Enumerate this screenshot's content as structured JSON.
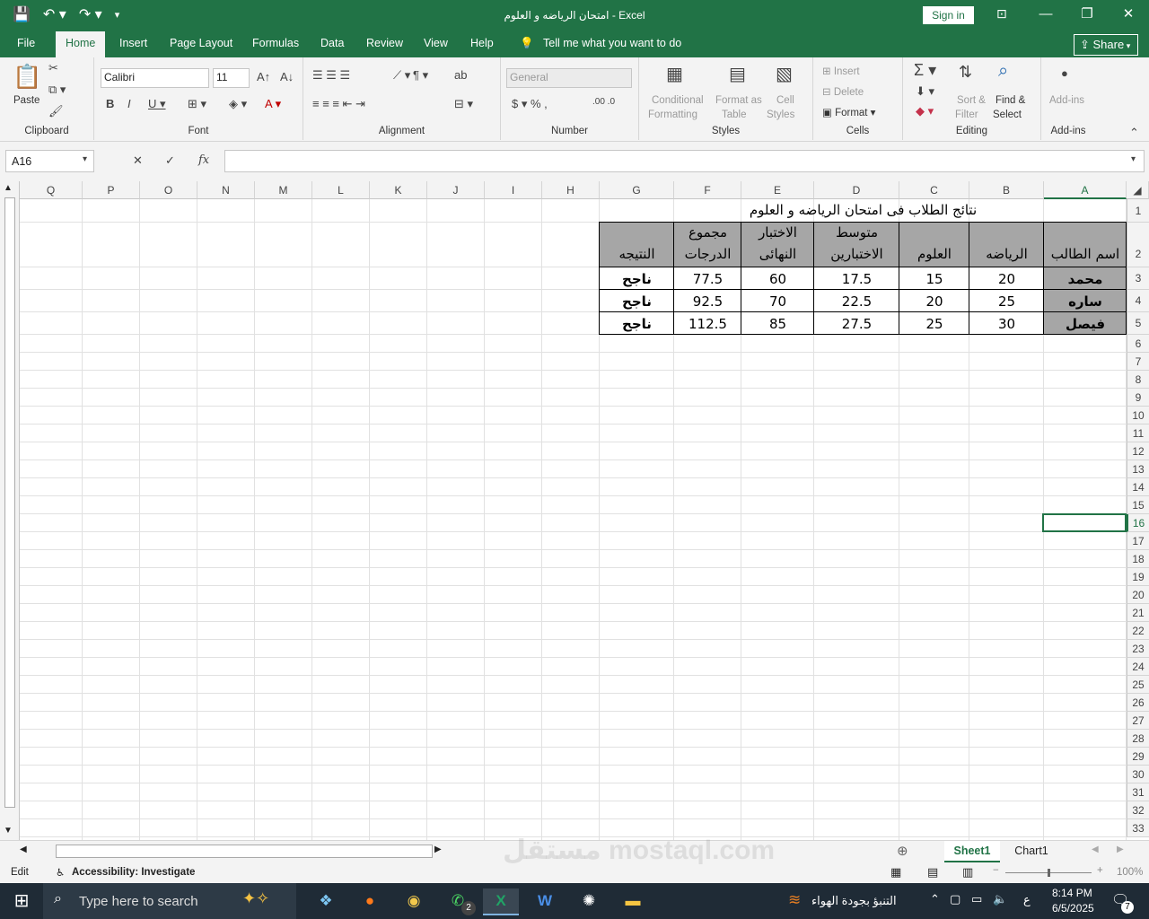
{
  "window": {
    "title": "امتحان الرياضه و العلوم  -  Excel",
    "signin": "Sign in",
    "share": "Share"
  },
  "tabs": [
    "File",
    "Home",
    "Insert",
    "Page Layout",
    "Formulas",
    "Data",
    "Review",
    "View",
    "Help"
  ],
  "tell_me": "Tell me what you want to do",
  "ribbon": {
    "paste": "Paste",
    "clipboard": "Clipboard",
    "font_name": "Calibri",
    "font_size": "11",
    "font": "Font",
    "alignment": "Alignment",
    "number_format": "General",
    "number": "Number",
    "conditional_1": "Conditional",
    "conditional_2": "Formatting",
    "format_as_1": "Format as",
    "format_as_2": "Table",
    "cell_styles_1": "Cell",
    "cell_styles_2": "Styles",
    "styles": "Styles",
    "insert": "Insert",
    "delete": "Delete",
    "format": "Format",
    "cells": "Cells",
    "sort_1": "Sort &",
    "sort_2": "Filter",
    "find_1": "Find &",
    "find_2": "Select",
    "editing": "Editing",
    "addins": "Add-ins",
    "addins_group": "Add-ins"
  },
  "formula_bar": {
    "name_box": "A16",
    "fx": "fx",
    "value": ""
  },
  "columns": [
    "Q",
    "P",
    "O",
    "N",
    "M",
    "L",
    "K",
    "J",
    "I",
    "H",
    "G",
    "F",
    "E",
    "D",
    "C",
    "B",
    "A"
  ],
  "rows": [
    "1",
    "2",
    "3",
    "4",
    "5",
    "6",
    "7",
    "8",
    "9",
    "10",
    "11",
    "12",
    "13",
    "14",
    "15",
    "16",
    "17",
    "18",
    "19",
    "20",
    "21",
    "22",
    "23",
    "24",
    "25",
    "26",
    "27",
    "28",
    "29",
    "30",
    "31",
    "32",
    "33"
  ],
  "table": {
    "title": "نتائج الطلاب فى امتحان الرياضه و العلوم",
    "headers": [
      {
        "l1": "",
        "l2": "اسم الطالب"
      },
      {
        "l1": "",
        "l2": "الرياضه"
      },
      {
        "l1": "",
        "l2": "العلوم"
      },
      {
        "l1": "متوسط",
        "l2": "الاختبارين"
      },
      {
        "l1": "الاختبار",
        "l2": "النهائى"
      },
      {
        "l1": "مجموع",
        "l2": "الدرجات"
      },
      {
        "l1": "",
        "l2": "النتيجه"
      }
    ],
    "rows": [
      [
        "محمد",
        "20",
        "15",
        "17.5",
        "60",
        "77.5",
        "ناجح"
      ],
      [
        "ساره",
        "25",
        "20",
        "22.5",
        "70",
        "92.5",
        "ناجح"
      ],
      [
        "فيصل",
        "30",
        "25",
        "27.5",
        "85",
        "112.5",
        "ناجح"
      ]
    ]
  },
  "sheets": [
    "Sheet1",
    "Chart1"
  ],
  "status": {
    "mode": "Edit",
    "accessibility": "Accessibility: Investigate",
    "zoom": "100%"
  },
  "taskbar": {
    "search": "Type here to search",
    "weather": "التنبؤ بجودة الهواء",
    "lang": "ع",
    "time": "8:14 PM",
    "date": "6/5/2025",
    "notifications": "7",
    "whatsapp_badge": "2"
  },
  "watermark": "مستقل mostaql.com"
}
